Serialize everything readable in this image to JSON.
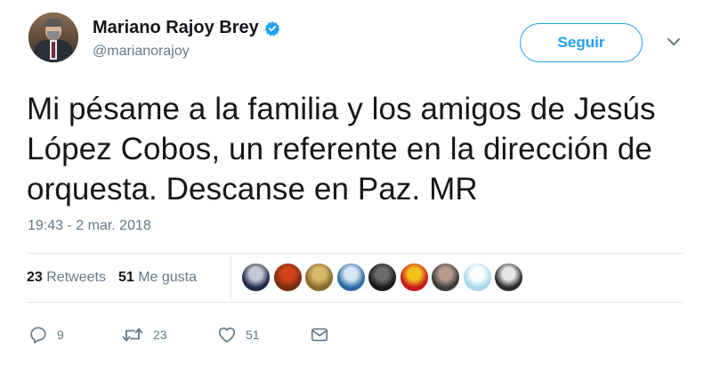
{
  "author": {
    "display_name": "Mariano Rajoy Brey",
    "handle": "@marianorajoy",
    "verified": true
  },
  "follow_button": {
    "label": "Seguir"
  },
  "tweet": {
    "text": "Mi pésame a la familia y los amigos de Jesús\nLópez Cobos, un referente en la dirección de\norquesta. Descanse en Paz. MR",
    "timestamp": "19:43 - 2 mar. 2018"
  },
  "stats": {
    "retweets_count": "23",
    "retweets_label": "Retweets",
    "likes_count": "51",
    "likes_label": "Me gusta"
  },
  "likers": [
    {
      "name": "liker-avatar-1",
      "colors": [
        "#1f2a4a",
        "#c7c7d6"
      ]
    },
    {
      "name": "liker-avatar-2",
      "colors": [
        "#7a2c10",
        "#d0431a"
      ]
    },
    {
      "name": "liker-avatar-3",
      "colors": [
        "#8a6a2a",
        "#d8b96a"
      ]
    },
    {
      "name": "liker-avatar-4",
      "colors": [
        "#2a6aa0",
        "#d6e6f2"
      ]
    },
    {
      "name": "liker-avatar-5",
      "colors": [
        "#1a1a1a",
        "#6a6a6a"
      ]
    },
    {
      "name": "liker-avatar-6",
      "colors": [
        "#c41a1a",
        "#f2c21a"
      ]
    },
    {
      "name": "liker-avatar-7",
      "colors": [
        "#3a3a3a",
        "#b89a8a"
      ]
    },
    {
      "name": "liker-avatar-8",
      "colors": [
        "#a8d8ee",
        "#ffffff"
      ]
    },
    {
      "name": "liker-avatar-9",
      "colors": [
        "#2a2a2a",
        "#e6e6e6"
      ]
    }
  ],
  "actions": {
    "reply_count": "9",
    "retweet_count": "23",
    "like_count": "51"
  },
  "icons": {
    "verified": "verified-badge-icon",
    "caret": "chevron-down-icon",
    "reply": "reply-icon",
    "retweet": "retweet-icon",
    "like": "heart-icon",
    "message": "direct-message-icon"
  },
  "colors": {
    "accent": "#1da1f2",
    "secondary_text": "#657786",
    "primary_text": "#14171a",
    "divider": "#e1e8ed"
  }
}
